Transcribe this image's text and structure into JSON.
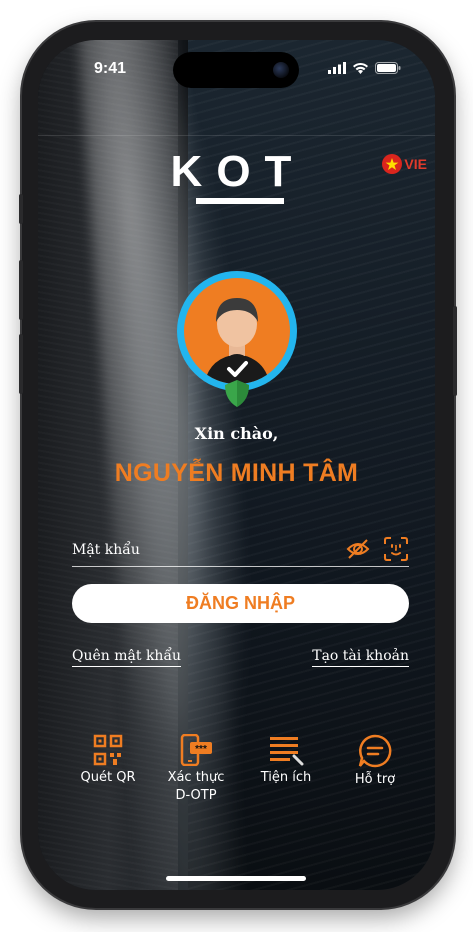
{
  "status": {
    "time": "9:41"
  },
  "brand": {
    "logo_text": "KOT"
  },
  "language": {
    "code": "VIE",
    "flag": "vietnam-flag"
  },
  "greeting": {
    "hello": "Xin chào,",
    "user_name": "NGUYỄN MINH TÂM"
  },
  "login": {
    "password_placeholder": "Mật khẩu",
    "submit_label": "ĐĂNG NHẬP",
    "forgot_label": "Quên mật khẩu",
    "create_label": "Tạo tài khoản"
  },
  "menu": [
    {
      "label": "Quét QR",
      "icon": "qr-scan-icon"
    },
    {
      "label": "Xác thực D-OTP",
      "label_line1": "Xác thực",
      "label_line2": "D-OTP",
      "icon": "otp-phone-icon"
    },
    {
      "label": "Tiện ích",
      "icon": "utilities-icon"
    },
    {
      "label": "Hỗ trợ",
      "icon": "chat-support-icon"
    }
  ],
  "colors": {
    "accent": "#ef7d22",
    "avatar_ring": "#23b5ee",
    "shield": "#3aa64a"
  }
}
